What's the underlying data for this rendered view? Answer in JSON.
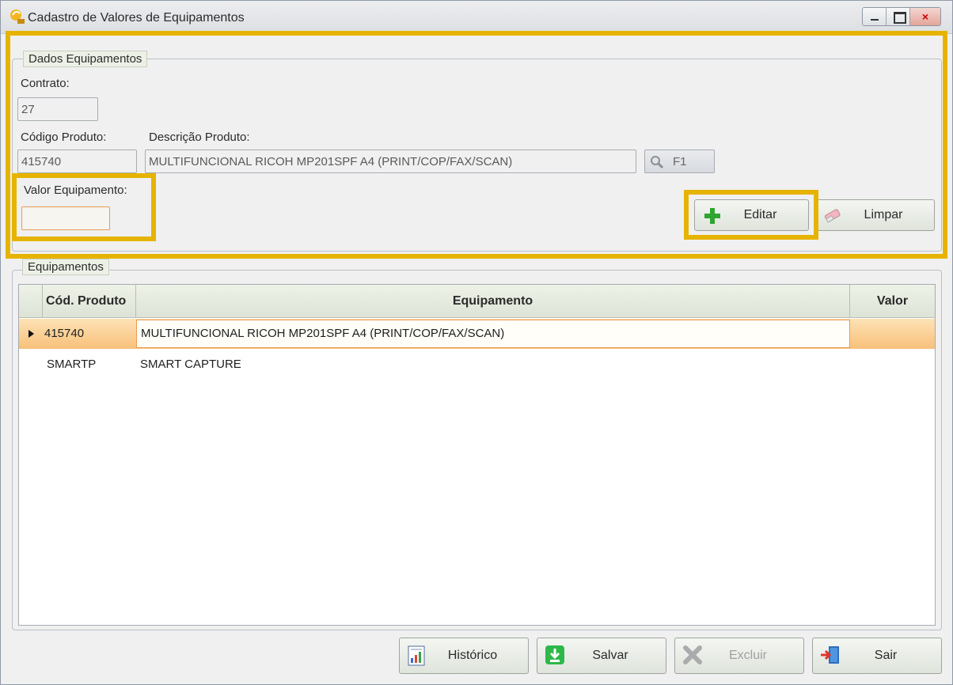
{
  "window": {
    "title": "Cadastro de Valores de Equipamentos",
    "close_glyph": "×"
  },
  "dados": {
    "legend": "Dados Equipamentos",
    "contrato_label": "Contrato:",
    "contrato_value": "27",
    "codigo_label": "Código Produto:",
    "codigo_value": "415740",
    "descricao_label": "Descrição Produto:",
    "descricao_value": "MULTIFUNCIONAL RICOH MP201SPF A4 (PRINT/COP/FAX/SCAN)",
    "f1_label": "F1",
    "valor_label": "Valor Equipamento:",
    "valor_value": "",
    "editar_label": "Editar",
    "limpar_label": "Limpar"
  },
  "equipamentos": {
    "legend": "Equipamentos",
    "columns": [
      "Cód. Produto",
      "Equipamento",
      "Valor"
    ],
    "rows": [
      {
        "codigo": "415740",
        "equipamento": "MULTIFUNCIONAL RICOH MP201SPF A4 (PRINT/COP/FAX/SCAN)",
        "valor": "",
        "selected": true
      },
      {
        "codigo": "SMARTP",
        "equipamento": "SMART CAPTURE",
        "valor": "",
        "selected": false
      }
    ]
  },
  "footer": {
    "historico_label": "Histórico",
    "salvar_label": "Salvar",
    "excluir_label": "Excluir",
    "sair_label": "Sair"
  },
  "colors": {
    "highlight": "#e6b400",
    "selected_row": "#f8c07a",
    "edit_border": "#e89b53"
  }
}
